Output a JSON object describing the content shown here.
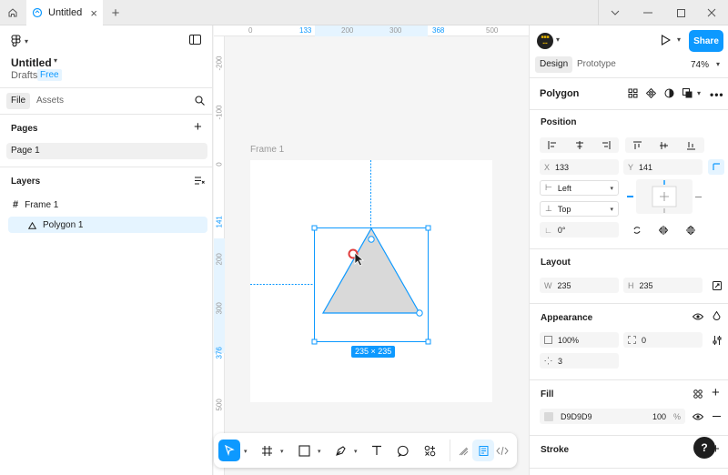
{
  "titlebar": {
    "tab_title": "Untitled",
    "window_controls": [
      "chevron-down-icon",
      "minimize-icon",
      "maximize-icon",
      "close-icon"
    ]
  },
  "left_panel": {
    "file_name": "Untitled",
    "location": "Drafts",
    "plan_badge": "Free",
    "tabs": [
      "File",
      "Assets"
    ],
    "pages_title": "Pages",
    "pages": [
      "Page 1"
    ],
    "layers_title": "Layers",
    "layers": [
      {
        "name": "Frame 1",
        "icon": "frame-icon"
      },
      {
        "name": "Polygon 1",
        "icon": "polygon-icon"
      }
    ]
  },
  "canvas": {
    "ruler_top": [
      "0",
      "133",
      "200",
      "300",
      "368",
      "500"
    ],
    "ruler_left": [
      "-200",
      "-100",
      "0",
      "141",
      "200",
      "300",
      "376",
      "500"
    ],
    "frame_label": "Frame 1",
    "selection_size": "235 × 235"
  },
  "right_panel": {
    "share_label": "Share",
    "tabs": [
      "Design",
      "Prototype"
    ],
    "zoom": "74%",
    "selection_title": "Polygon",
    "position": {
      "title": "Position",
      "x_label": "X",
      "x": "133",
      "y_label": "Y",
      "y": "141",
      "h_constraint": "Left",
      "v_constraint": "Top",
      "rotation": "0°"
    },
    "layout": {
      "title": "Layout",
      "w_label": "W",
      "w": "235",
      "h_label": "H",
      "h": "235"
    },
    "appearance": {
      "title": "Appearance",
      "opacity": "100%",
      "radius": "0",
      "count": "3"
    },
    "fill": {
      "title": "Fill",
      "hex": "D9D9D9",
      "opacity": "100",
      "unit": "%"
    },
    "stroke": {
      "title": "Stroke"
    },
    "help_label": "?"
  },
  "colors": {
    "accent": "#0d99ff",
    "polygon_fill": "#d9d9d9"
  }
}
